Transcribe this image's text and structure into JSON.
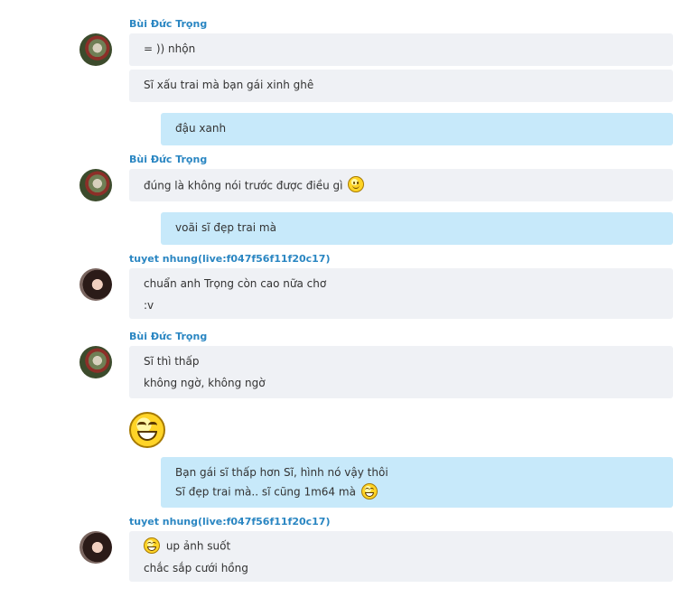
{
  "messages": [
    {
      "sender": "Bùi Đức Trọng",
      "lines": [
        "= )) nhộn",
        "Sĩ xấu trai mà bạn gái xinh ghê"
      ]
    },
    {
      "outgoing": [
        "đậu xanh"
      ]
    },
    {
      "sender": "Bùi Đức Trọng",
      "lines": [
        "đúng là không nói trước được điều gì"
      ],
      "emoticon": "smile-icon"
    },
    {
      "outgoing": [
        "voãi sĩ đẹp trai mà"
      ]
    },
    {
      "sender": "tuyet nhung(live:f047f56f11f20c17)",
      "lines": [
        "chuẩn anh Trọng còn cao nữa chơ",
        ":v"
      ]
    },
    {
      "sender": "Bùi Đức Trọng",
      "lines": [
        "Sĩ thì thấp",
        "không ngờ, không ngờ"
      ],
      "emoticon": "laugh-icon"
    },
    {
      "outgoing": [
        "Bạn gái sĩ thấp hơn Sĩ, hình nó vậy thôi",
        "Sĩ đẹp trai mà.. sĩ cũng 1m64 mà"
      ]
    },
    {
      "sender": "tuyet nhung(live:f047f56f11f20c17)",
      "lines": [
        "up ảnh suốt",
        "chắc sắp cưới hồng"
      ]
    }
  ],
  "colors": {
    "sender": "#2a86c2",
    "incoming_bubble": "#eff1f5",
    "outgoing_bubble": "#c7e9fa"
  }
}
